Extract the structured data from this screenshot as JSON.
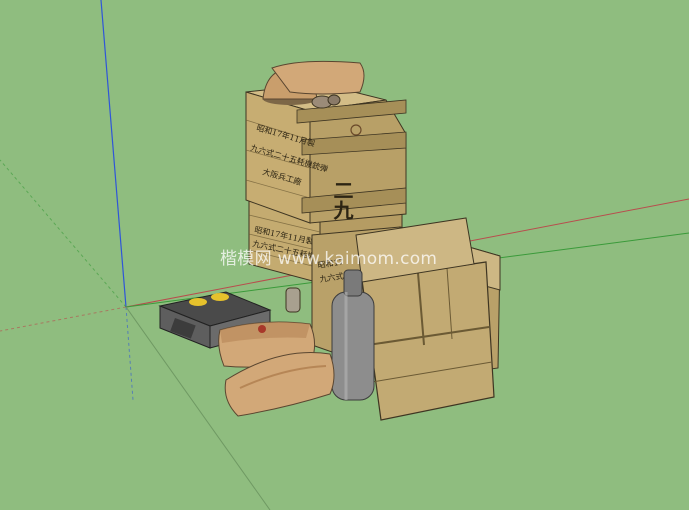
{
  "scene": {
    "background_color": "#8fbd7f",
    "axis_colors": {
      "blue": "#2f56d8",
      "red": "#b84d4d",
      "green": "#3a9a3a"
    }
  },
  "watermark": {
    "text": "楷模网 www.kaimom.com"
  },
  "upper_crate": {
    "side_code": "二九",
    "front_lines": [
      "昭和17年11月製",
      "九六式二十五耗機銃弾",
      "大阪兵工廠"
    ]
  },
  "lower_crate": {
    "front_lines": [
      "昭和17年11月製",
      "九六式二十五耗機銃弾"
    ],
    "side_lines": [
      "昭和17",
      "九六式"
    ]
  },
  "materials": {
    "wood_light": "#c9b27a",
    "wood_mid": "#b59c63",
    "wood_dark": "#8e7745",
    "sack": "#d2a878",
    "sack_shade": "#b68656",
    "metal": "#8d8d8d",
    "lamp_yellow": "#e6c22c"
  }
}
